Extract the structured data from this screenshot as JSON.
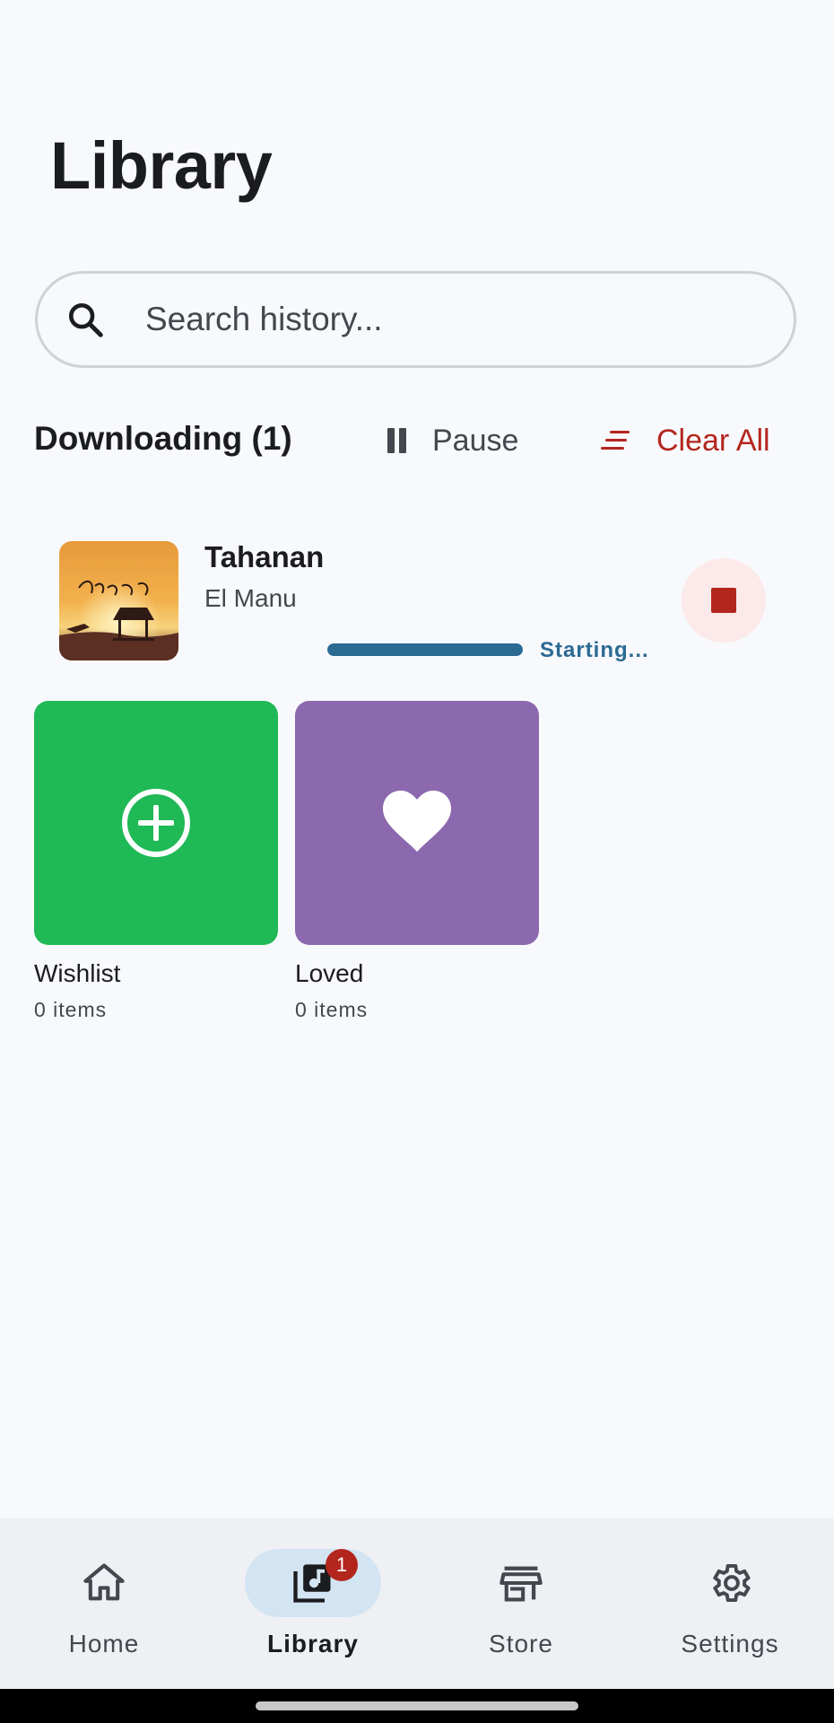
{
  "page": {
    "title": "Library"
  },
  "search": {
    "placeholder": "Search history..."
  },
  "downloads": {
    "title": "Downloading (1)",
    "pause_label": "Pause",
    "clear_label": "Clear All",
    "items": [
      {
        "title": "Tahanan",
        "artist": "El Manu",
        "status": "Starting...",
        "progress": 1.0
      }
    ]
  },
  "collections": [
    {
      "label": "Wishlist",
      "count": "0 items",
      "color": "#1fb955",
      "icon": "add-circle-icon"
    },
    {
      "label": "Loved",
      "count": "0 items",
      "color": "#8c69ae",
      "icon": "heart-icon"
    }
  ],
  "nav": {
    "items": [
      {
        "label": "Home",
        "icon": "home-icon"
      },
      {
        "label": "Library",
        "icon": "library-music-icon",
        "badge": "1",
        "active": true
      },
      {
        "label": "Store",
        "icon": "store-icon"
      },
      {
        "label": "Settings",
        "icon": "gear-icon"
      }
    ]
  },
  "colors": {
    "accent_blue": "#2b6a93",
    "danger": "#b3261e",
    "nav_active_pill": "#d3e4f2"
  }
}
